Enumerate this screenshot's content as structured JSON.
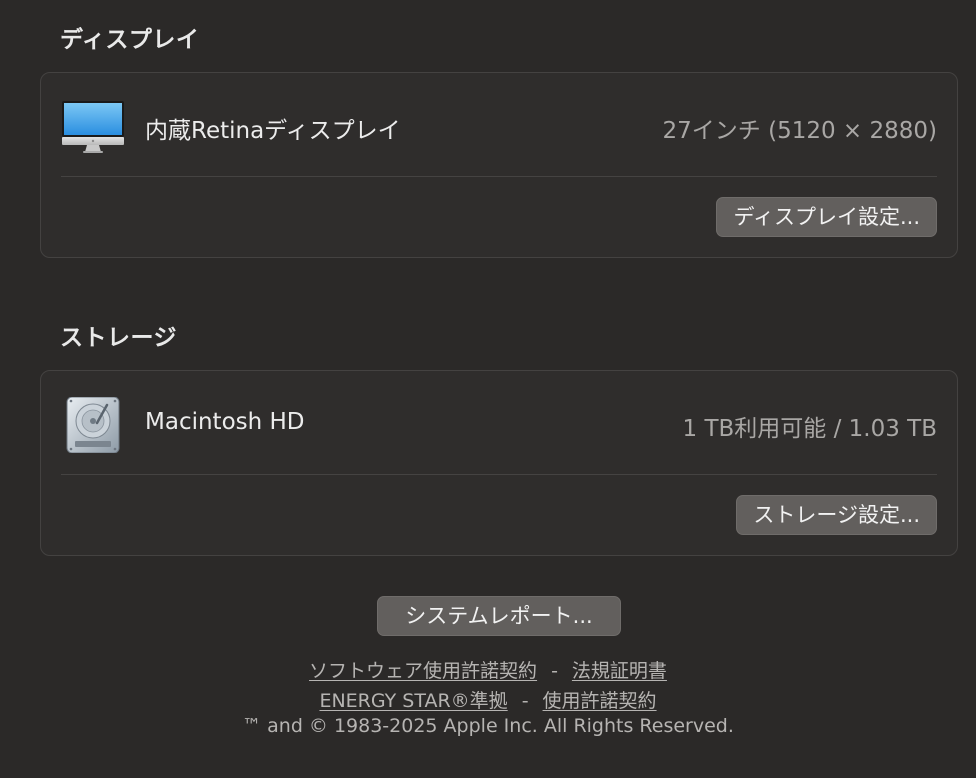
{
  "display_section": {
    "title": "ディスプレイ",
    "name": "内蔵Retinaディスプレイ",
    "value": "27インチ (5120 × 2880)",
    "button_label": "ディスプレイ設定...",
    "icon": "imac-icon"
  },
  "storage_section": {
    "title": "ストレージ",
    "name": "Macintosh HD",
    "value": "1 TB利用可能 / 1.03 TB",
    "button_label": "ストレージ設定...",
    "icon": "hard-drive-icon"
  },
  "system_report_label": "システムレポート...",
  "footer": {
    "link_software_license": "ソフトウェア使用許諾契約",
    "link_regulatory": "法規証明書",
    "link_energy_star": "ENERGY STAR®準拠",
    "link_license": "使用許諾契約",
    "separator": "-",
    "copyright": "™ and © 1983-2025 Apple Inc. All Rights Reserved."
  },
  "colors": {
    "background": "#2b2928",
    "panel": "#2f2d2c",
    "button": "#625f5d"
  }
}
